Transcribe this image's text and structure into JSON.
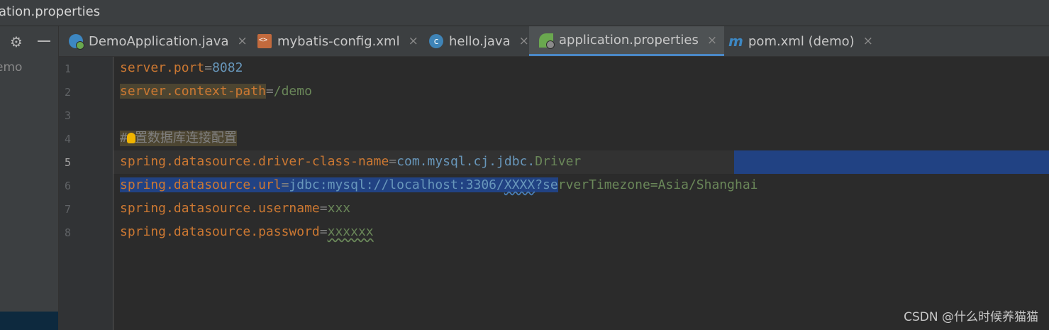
{
  "window": {
    "title": "ation.properties"
  },
  "sidebar": {
    "project_label": "emo",
    "gear_icon": "gear-icon",
    "minimize_icon": "minus-icon"
  },
  "tabs": [
    {
      "label": "DemoApplication.java",
      "icon": "spring-boot-java-icon",
      "close": "×"
    },
    {
      "label": "mybatis-config.xml",
      "icon": "xml-file-icon",
      "close": "×"
    },
    {
      "label": "hello.java",
      "icon": "java-class-icon",
      "icon_text": "c",
      "close": "×"
    },
    {
      "label": "application.properties",
      "icon": "spring-properties-icon",
      "close": "×",
      "active": true
    },
    {
      "label": "pom.xml (demo)",
      "icon": "maven-icon",
      "icon_text": "m",
      "close": "×"
    }
  ],
  "editor": {
    "current_line": 5,
    "line_numbers": [
      "1",
      "2",
      "3",
      "4",
      "5",
      "6",
      "7",
      "8"
    ],
    "lines": [
      {
        "key": "server.port",
        "eq": "=",
        "value": "8082"
      },
      {
        "key": "server.context-path",
        "eq": "=",
        "value": "/demo"
      },
      {
        "text": ""
      },
      {
        "hash": "#",
        "comment": "置数据库连接配置"
      },
      {
        "key": "spring.datasource.driver-class-name",
        "eq": "=",
        "value_a": "com.mysql.cj.jdbc.",
        "value_b": "Driver"
      },
      {
        "key": "spring.datasource.url",
        "eq": "=",
        "value_a": "jdbc:mysql://localhost:3306/",
        "value_b": "XXXX",
        "value_c": "?se",
        "value_d": "rverTimezone=Asia/Shanghai"
      },
      {
        "key": "spring.datasource.username",
        "eq": "=",
        "value": "xxx"
      },
      {
        "key": "spring.datasource.password",
        "eq": "=",
        "value": "xxxxxx"
      }
    ]
  },
  "watermark": "CSDN @什么时候养猫猫",
  "colors": {
    "keyword": "#cc7832",
    "number": "#6897bb",
    "string": "#6a8759",
    "selection": "#214283",
    "active_tab_underline": "#4a88c7"
  }
}
